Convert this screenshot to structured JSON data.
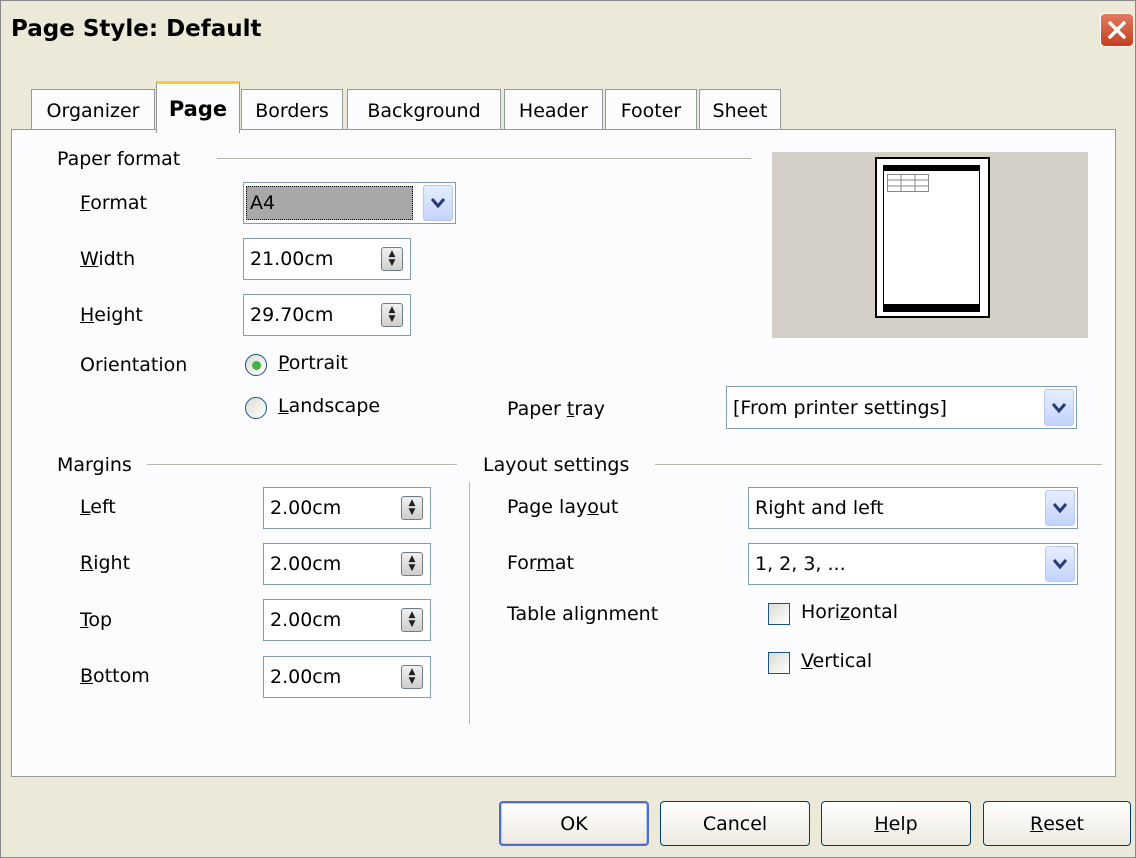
{
  "window": {
    "title": "Page Style: Default"
  },
  "tabs": [
    "Organizer",
    "Page",
    "Borders",
    "Background",
    "Header",
    "Footer",
    "Sheet"
  ],
  "active_tab": "Page",
  "paper_format": {
    "group_title": "Paper format",
    "format": {
      "label_pre": "",
      "label_u": "F",
      "label_post": "ormat",
      "value": "A4"
    },
    "width": {
      "label_pre": "",
      "label_u": "W",
      "label_post": "idth",
      "value": "21.00cm"
    },
    "height": {
      "label_pre": "",
      "label_u": "H",
      "label_post": "eight",
      "value": "29.70cm"
    },
    "orientation": {
      "label": "Orientation",
      "portrait": {
        "label_pre": "",
        "label_u": "P",
        "label_post": "ortrait",
        "selected": true
      },
      "landscape": {
        "label_pre": "",
        "label_u": "L",
        "label_post": "andscape",
        "selected": false
      }
    },
    "paper_tray": {
      "label_pre": "Paper ",
      "label_u": "t",
      "label_post": "ray",
      "value": "[From printer settings]"
    }
  },
  "margins": {
    "group_title": "Margins",
    "left": {
      "label_pre": "",
      "label_u": "L",
      "label_post": "eft",
      "value": "2.00cm"
    },
    "right": {
      "label_pre": "",
      "label_u": "R",
      "label_post": "ight",
      "value": "2.00cm"
    },
    "top": {
      "label_pre": "",
      "label_u": "T",
      "label_post": "op",
      "value": "2.00cm"
    },
    "bottom": {
      "label_pre": "",
      "label_u": "B",
      "label_post": "ottom",
      "value": "2.00cm"
    }
  },
  "layout": {
    "group_title": "Layout settings",
    "page_layout": {
      "label_pre": "Page lay",
      "label_u": "o",
      "label_post": "ut",
      "value": "Right and left"
    },
    "format": {
      "label_pre": "For",
      "label_u": "m",
      "label_post": "at",
      "value": "1, 2, 3, ..."
    },
    "table_alignment": {
      "label": "Table alignment",
      "horizontal": {
        "label_pre": "Hori",
        "label_u": "z",
        "label_post": "ontal",
        "checked": false
      },
      "vertical": {
        "label_pre": "",
        "label_u": "V",
        "label_post": "ertical",
        "checked": false
      }
    }
  },
  "buttons": {
    "ok": {
      "label_pre": "OK",
      "label_u": "",
      "label_post": ""
    },
    "cancel": {
      "label_pre": "Cancel",
      "label_u": "",
      "label_post": ""
    },
    "help": {
      "label_pre": "",
      "label_u": "H",
      "label_post": "elp"
    },
    "reset": {
      "label_pre": "",
      "label_u": "R",
      "label_post": "eset"
    }
  },
  "icons": {
    "close": "close-icon",
    "dropdown": "chevron-down-icon",
    "spin": "spin-updown-icon"
  },
  "colors": {
    "window_bg": "#ece9d8",
    "panel_bg": "#fcfcfe",
    "tab_highlight": "#ffc83c",
    "close_btn": "#d45a36"
  }
}
